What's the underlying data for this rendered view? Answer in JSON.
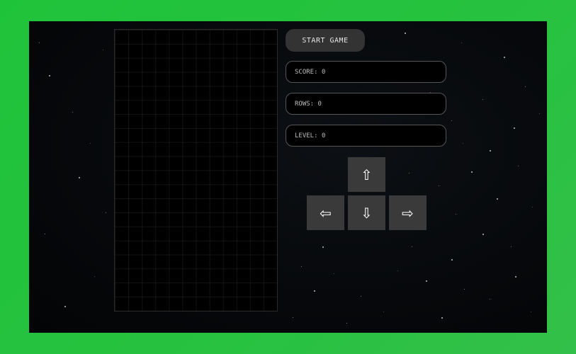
{
  "controls": {
    "start_label": "START GAME"
  },
  "stats": {
    "score": {
      "label": "SCORE:",
      "value": "0"
    },
    "rows": {
      "label": "ROWS:",
      "value": "0"
    },
    "level": {
      "label": "LEVEL:",
      "value": "0"
    }
  },
  "arrows": {
    "up": "⇧",
    "left": "⇦",
    "down": "⇩",
    "right": "⇨"
  },
  "colors": {
    "frame": "#1fc33a",
    "button": "#333333",
    "arrow_button": "#3a3a3a",
    "panel_border": "#555555"
  }
}
